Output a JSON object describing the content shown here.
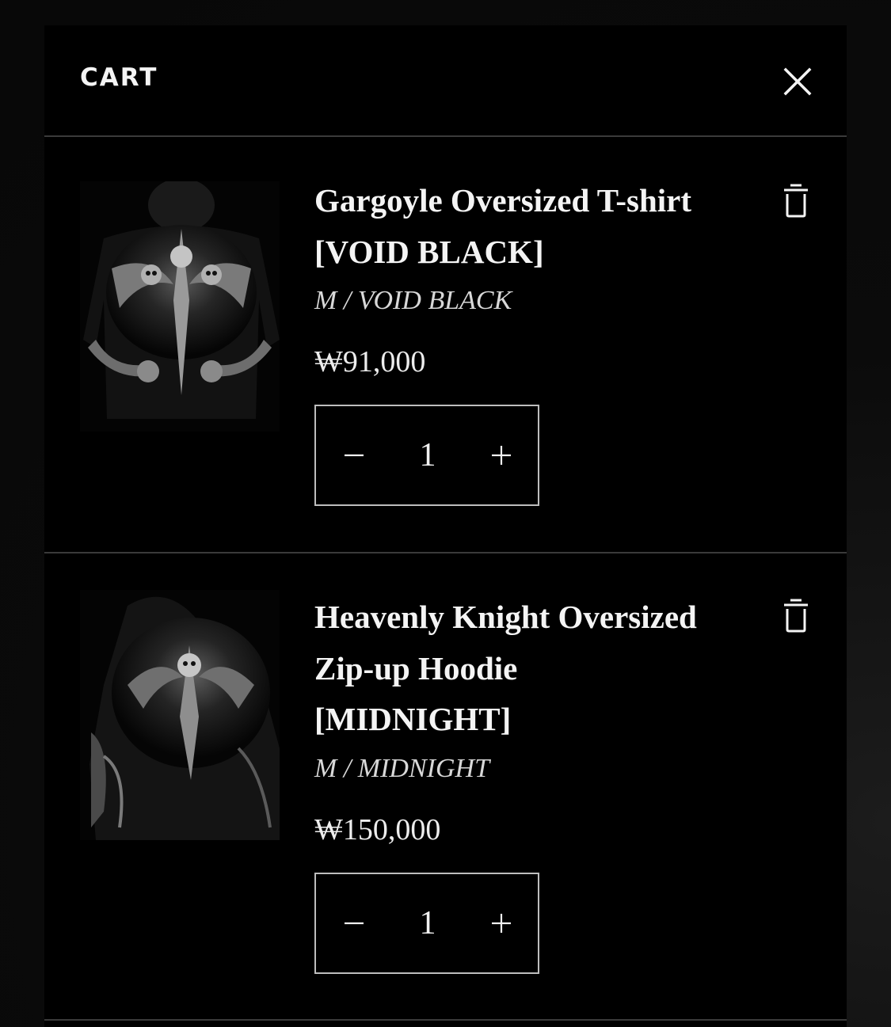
{
  "cart": {
    "title": "CART",
    "close_icon": "close-icon",
    "items": [
      {
        "name_line1": "Gargoyle Oversized T-shirt",
        "name_line2": "[VOID BLACK]",
        "variant": "M / VOID BLACK",
        "price": "₩91,000",
        "quantity": "1",
        "minus_label": "−",
        "plus_label": "+",
        "image_icon": "product-image-gargoyle-tshirt",
        "remove_icon": "trash-icon"
      },
      {
        "name_line1": "Heavenly Knight Oversized",
        "name_line2": "Zip-up Hoodie",
        "name_line3": "[MIDNIGHT]",
        "variant": "M / MIDNIGHT",
        "price": "₩150,000",
        "quantity": "1",
        "minus_label": "−",
        "plus_label": "+",
        "image_icon": "product-image-heavenly-knight-hoodie",
        "remove_icon": "trash-icon"
      }
    ]
  },
  "colors": {
    "background": "#000000",
    "text": "#f4f4f4",
    "divider": "#3a3a3a",
    "border": "#bdbdbd"
  }
}
